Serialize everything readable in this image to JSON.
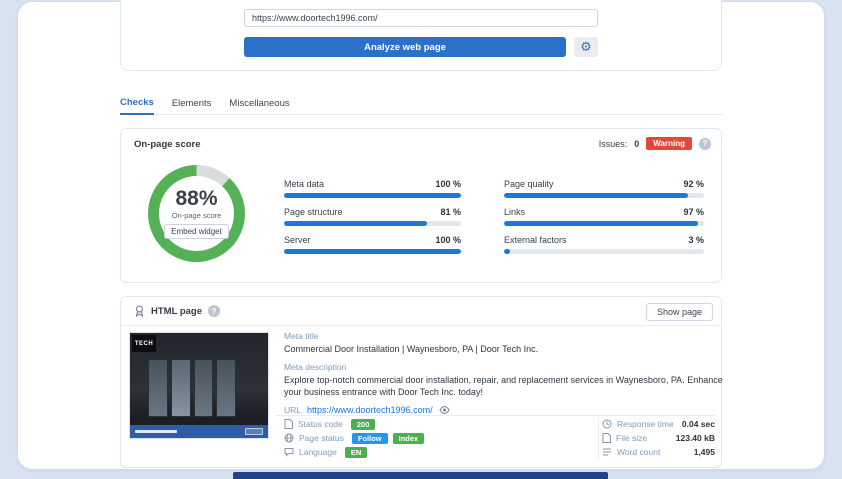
{
  "colors": {
    "page_bg": "#d9e2f0",
    "accent_blue": "#2a71c7",
    "bar_blue": "#1e78dc",
    "warning_red": "#e2483d",
    "badge_green": "#4caf50",
    "badge_blue": "#2196f3"
  },
  "icons": {
    "gear": "⚙",
    "help": "?"
  },
  "analyzer": {
    "url_value": "https://www.doortech1996.com/",
    "analyze_label": "Analyze web page"
  },
  "tabs": [
    {
      "label": "Checks"
    },
    {
      "label": "Elements"
    },
    {
      "label": "Miscellaneous"
    }
  ],
  "score_card": {
    "title": "On-page score",
    "issues_label": "Issues:",
    "issues_count": "0",
    "warning_label": "Warning",
    "score_text": "88%",
    "score_number": 88,
    "score_caption": "On-page score",
    "embed_label": "Embed widget",
    "donut_color": "#55b156",
    "donut_rest_color": "#d8dcdf",
    "metrics": [
      {
        "label": "Meta data",
        "value": "100 %",
        "percent": 100
      },
      {
        "label": "Page structure",
        "value": "81 %",
        "percent": 81
      },
      {
        "label": "Server",
        "value": "100 %",
        "percent": 100
      },
      {
        "label": "Page quality",
        "value": "92 %",
        "percent": 92
      },
      {
        "label": "Links",
        "value": "97 %",
        "percent": 97
      },
      {
        "label": "External factors",
        "value": "3 %",
        "percent": 3
      }
    ]
  },
  "html_card": {
    "title": "HTML page",
    "show_page_label": "Show page",
    "meta_title_label": "Meta title",
    "meta_title": "Commercial Door Installation | Waynesboro, PA | Door Tech Inc.",
    "meta_description_label": "Meta description",
    "meta_description": "Explore top-notch commercial door installation, repair, and replacement services in Waynesboro, PA. Enhance your business entrance with Door Tech Inc. today!",
    "url_label": "URL",
    "url_link": "https://www.doortech1996.com/",
    "thumbnail_logo": "TECH",
    "stats_left": [
      {
        "label": "Status code",
        "badges": [
          {
            "text": "200",
            "color": "#4caf50"
          }
        ]
      },
      {
        "label": "Page status",
        "badges": [
          {
            "text": "Follow",
            "color": "#2196f3"
          },
          {
            "text": "Index",
            "color": "#4caf50"
          }
        ]
      },
      {
        "label": "Language",
        "badges": [
          {
            "text": "EN",
            "color": "#4caf50"
          }
        ]
      }
    ],
    "stats_right": [
      {
        "label": "Response time",
        "value": "0.04 sec"
      },
      {
        "label": "File size",
        "value": "123.40 kB"
      },
      {
        "label": "Word count",
        "value": "1,495"
      }
    ]
  }
}
